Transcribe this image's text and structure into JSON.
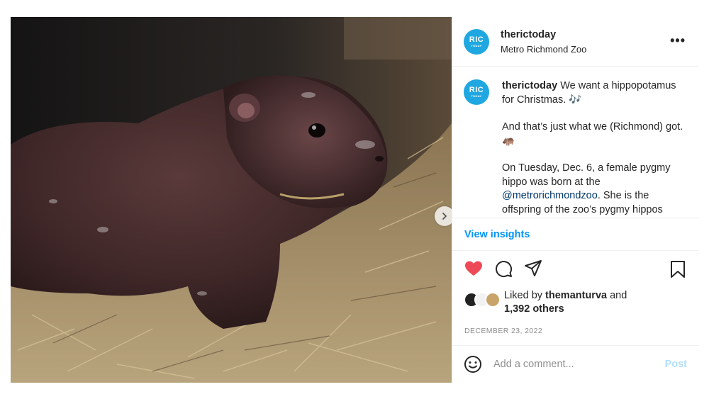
{
  "post": {
    "username": "therictoday",
    "location": "Metro Richmond Zoo",
    "avatar_text": "RIC",
    "avatar_subtext": "TODAY",
    "more_label": "•••",
    "caption": {
      "user": "therictoday",
      "line1": " We want a hippopotamus for Christmas. 🎶",
      "line2": "And that’s just what we (Richmond) got. 🦛",
      "line3_pre": "On Tuesday, Dec. 6, a female pygmy hippo was born at the ",
      "mention": "@metrorichmondzoo",
      "line3_post": ". She is the offspring of the zoo’s pygmy hippos Lizzy and Corey, who are expected to"
    },
    "view_insights": "View insights",
    "likes": {
      "prefix": "Liked by ",
      "liker": "themanturva",
      "middle": " and",
      "others": "1,392 others"
    },
    "date": "DECEMBER 23, 2022",
    "comment": {
      "placeholder": "Add a comment...",
      "post_label": "Post"
    }
  },
  "icons": {
    "like": "heart-icon",
    "comment": "comment-icon",
    "share": "share-icon",
    "save": "bookmark-icon",
    "emoji": "emoji-icon",
    "next": "chevron-right-icon"
  },
  "colors": {
    "accent_blue": "#0095f6",
    "heart_red": "#ed4956",
    "post_disabled": "#b2dffc",
    "avatar_blue": "#1ea7e1",
    "mention": "#00376b",
    "muted": "#8e8e8e"
  }
}
